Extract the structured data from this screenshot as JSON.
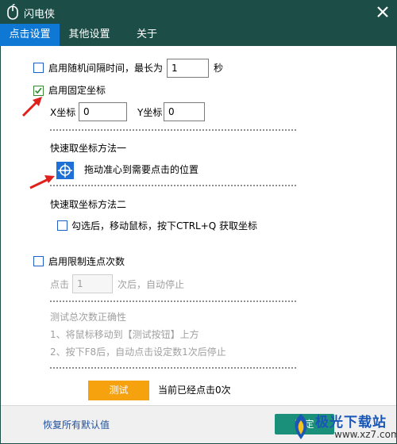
{
  "window": {
    "title": "闪电侠"
  },
  "tabs": [
    {
      "label": "点击设置",
      "active": true
    },
    {
      "label": "其他设置",
      "active": false
    },
    {
      "label": "关于",
      "active": false
    }
  ],
  "random_interval": {
    "label": "启用随机间隔时间，最长为",
    "value": "1",
    "unit": "秒",
    "checked": false
  },
  "fixed_coords": {
    "label": "启用固定坐标",
    "checked": true,
    "x_label": "X坐标",
    "x_value": "0",
    "y_label": "Y坐标",
    "y_value": "0"
  },
  "method1": {
    "title": "快速取坐标方法一",
    "drag_hint": "拖动准心到需要点击的位置"
  },
  "method2": {
    "title": "快速取坐标方法二",
    "label": "勾选后，移动鼠标，按下CTRL+Q 获取坐标",
    "checked": false
  },
  "limit": {
    "label": "启用限制连点次数",
    "checked": false,
    "prefix": "点击",
    "value": "1",
    "suffix": "次后，自动停止"
  },
  "test": {
    "title": "测试总次数正确性",
    "step1": "1、将鼠标移动到【测试按钮】上方",
    "step2": "2、按下F8后，自动点击设定数1次后停止",
    "button": "测试",
    "status": "当前已经点击0次"
  },
  "footer": {
    "reset": "恢复所有默认值",
    "ok": "确定"
  },
  "watermark": {
    "brand": "极光下载站",
    "url": "www.xz7.com"
  },
  "colors": {
    "titlebar": "#1d4d47",
    "active_tab": "#0f78d4",
    "test_button": "#f6a10e",
    "ok_button": "#1a8f7a",
    "arrow": "#e0201c"
  }
}
